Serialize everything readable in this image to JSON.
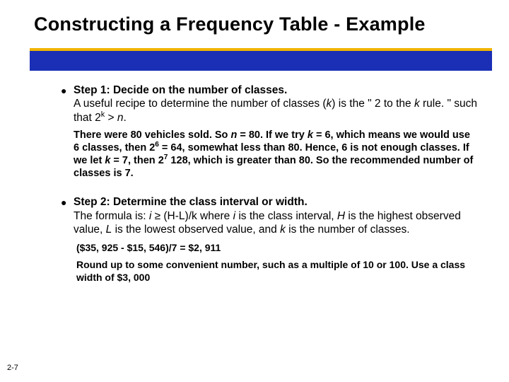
{
  "title": "Constructing a Frequency Table - Example",
  "step1": {
    "heading": "Step 1: Decide on the number of classes.",
    "body_a": "A useful recipe to determine the number of classes (",
    "body_k": "k",
    "body_b": ") is the \" 2 to the ",
    "body_k2": "k",
    "body_c": " rule. \"  such that 2",
    "body_sup": "k",
    "body_d": " > ",
    "body_n": "n",
    "body_e": ".",
    "note_a": "There were 80 vehicles sold. So ",
    "note_n": "n",
    "note_b": " = 80. If we try ",
    "note_k": "k",
    "note_c": " =  6, which means we would use 6 classes, then 2",
    "note_sup6": "6",
    "note_d": "  = 64, somewhat less than 80. Hence, 6 is not enough classes. If we let ",
    "note_k2": "k",
    "note_e": " = 7, then 2",
    "note_sup7": "7",
    "note_f": " 128, which is greater than 80. So the recommended number of classes is 7."
  },
  "step2": {
    "heading": "Step 2: Determine the class interval or width.",
    "body_a": "The formula is: ",
    "body_i": "i",
    "body_b": " ",
    "body_ge": "≥",
    "body_c": " (H-L)/k where ",
    "body_i2": "i",
    "body_d": " is the class interval, ",
    "body_h": "H",
    "body_e": " is the highest observed value, ",
    "body_l": "L",
    "body_f": " is the lowest observed value, and ",
    "body_k": "k",
    "body_g": " is the number of classes.",
    "calc": "($35, 925 - $15, 546)/7 = $2, 911",
    "round": "Round up to some convenient number, such as a multiple of 10 or 100. Use a class width of $3, 000"
  },
  "page_num": "2-7"
}
